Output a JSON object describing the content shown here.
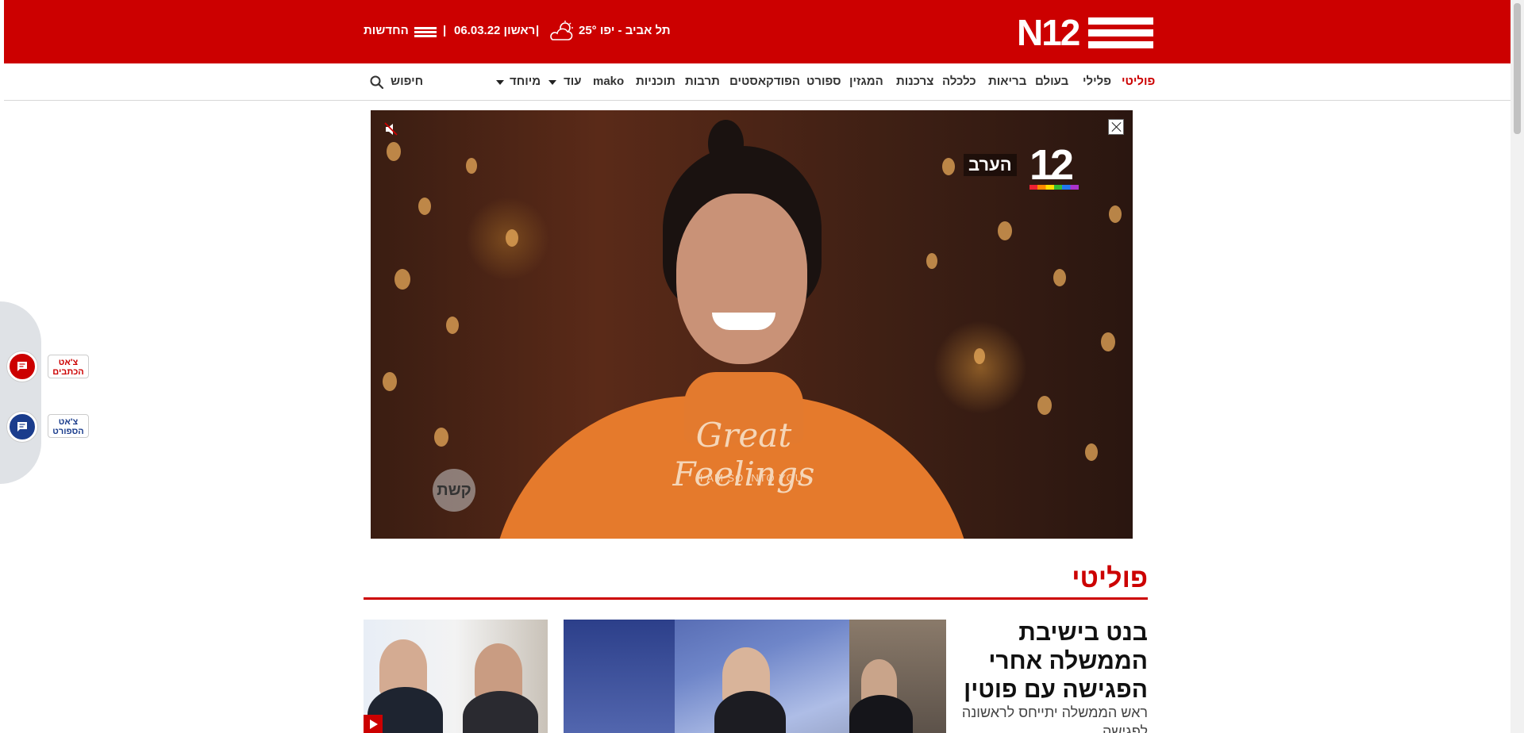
{
  "header": {
    "logo_text": "N12",
    "location": "תל אביב - יפו",
    "temperature": "25°",
    "date": "ראשון 06.03.22",
    "separator": "|",
    "news_menu": "החדשות",
    "icons": {
      "weather": "partly-cloudy-icon",
      "menu": "hamburger-icon"
    }
  },
  "nav": {
    "items": [
      "פוליטי",
      "פלילי",
      "בעולם",
      "בריאות",
      "כלכלה",
      "צרכנות",
      "המגזין",
      "ספורט",
      "הפודקאסטים",
      "תרבות",
      "תוכניות",
      "mako",
      "עוד",
      "מיוחד"
    ],
    "active": "פוליטי",
    "search_label": "חיפוש"
  },
  "video": {
    "channel_number": "12",
    "channel_label": "הערב",
    "shirt_text": "Great Feelings",
    "shirt_subtext": "I AM SO INTO YOU",
    "watermark": "קשת",
    "icons": {
      "mute": "mute-icon",
      "close": "close-icon"
    }
  },
  "section": {
    "title": "פוליטי",
    "headline": "בנט בישיבת הממשלה אחרי הפגישה עם פוטין",
    "subline": "ראש הממשלה יתייחס לראשונה לפגישה"
  },
  "chat": {
    "reporters_label": "צ'אט הכתבים",
    "sport_label": "צ'אט הספורט"
  },
  "colors": {
    "brand_red": "#cc0000",
    "sport_blue": "#1a3c8c"
  }
}
